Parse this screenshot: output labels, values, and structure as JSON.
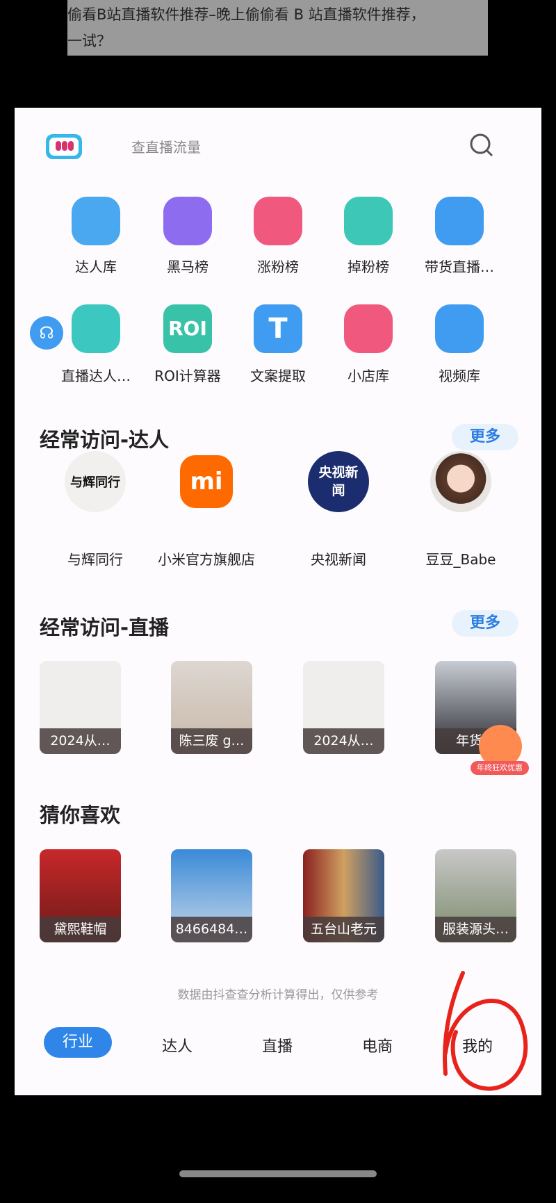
{
  "banner": {
    "line1": "偷看B站直播软件推荐–晚上偷偷看 B 站直播软件推荐，",
    "line2": "一试？"
  },
  "header": {
    "search_placeholder": "查直播流量",
    "logo_icon": "chart-bubble-logo",
    "search_icon": "search-icon"
  },
  "tools": [
    {
      "label": "达人库",
      "color": "#4aa8f0"
    },
    {
      "label": "黑马榜",
      "color": "#8d6cf0"
    },
    {
      "label": "涨粉榜",
      "color": "#f0587e"
    },
    {
      "label": "掉粉榜",
      "color": "#3cc7b7"
    },
    {
      "label": "带货直播…",
      "color": "#3f9cf0"
    },
    {
      "label": "直播达人…",
      "color": "#3cc7c0"
    },
    {
      "label": "ROI计算器",
      "color": "#38c2a8",
      "glyph": "ROI"
    },
    {
      "label": "文案提取",
      "color": "#3f9cf0",
      "glyph": "T"
    },
    {
      "label": "小店库",
      "color": "#f0587e"
    },
    {
      "label": "视频库",
      "color": "#3f9cf0"
    }
  ],
  "sections": {
    "frequent_creators": {
      "title": "经常访问-达人",
      "more": "更多",
      "items": [
        {
          "name": "与辉同行",
          "avatar_text": "与辉同行"
        },
        {
          "name": "小米官方旗舰店",
          "avatar_text": "mi"
        },
        {
          "name": "央视新闻",
          "avatar_text": "央视新闻"
        },
        {
          "name": "豆豆_Babe",
          "avatar_text": ""
        }
      ]
    },
    "frequent_live": {
      "title": "经常访问-直播",
      "more": "更多",
      "items": [
        {
          "caption": "2024从…"
        },
        {
          "caption": "陈三废 g…"
        },
        {
          "caption": "2024从…"
        },
        {
          "caption": "年货节"
        }
      ],
      "promo_badge": "年终狂欢优惠"
    },
    "guess_you_like": {
      "title": "猜你喜欢",
      "items": [
        {
          "caption": "黛熙鞋帽"
        },
        {
          "caption": "8466484…"
        },
        {
          "caption": "五台山老元"
        },
        {
          "caption": "服装源头…"
        }
      ]
    }
  },
  "footer_note": "数据由抖查查分析计算得出，仅供参考",
  "bottom_nav": [
    {
      "label": "行业",
      "active": true
    },
    {
      "label": "达人"
    },
    {
      "label": "直播"
    },
    {
      "label": "电商"
    },
    {
      "label": "我的"
    }
  ],
  "annotation_color": "#e8231c"
}
